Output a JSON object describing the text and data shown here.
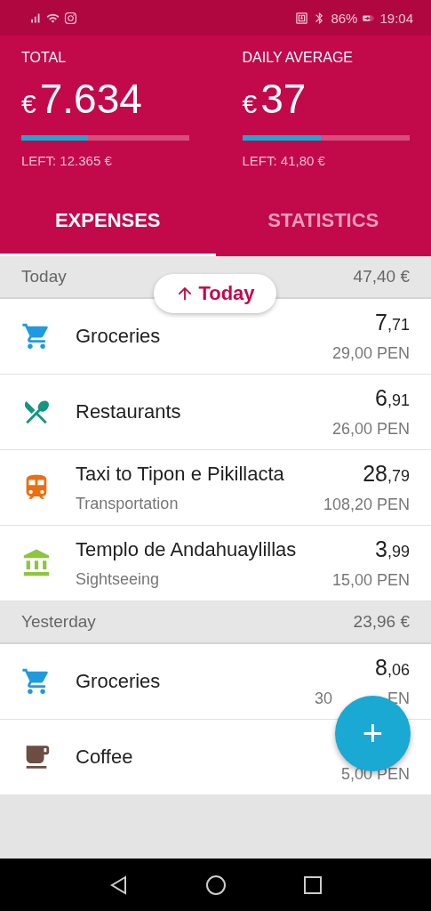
{
  "status_bar": {
    "battery": "86%",
    "time": "19:04"
  },
  "summary": [
    {
      "label": "TOTAL",
      "currency": "€",
      "value": "7.634",
      "level": 0.4,
      "left": "LEFT: 12.365 €"
    },
    {
      "label": "DAILY AVERAGE",
      "currency": "€",
      "value": "37",
      "level": 0.47,
      "left": "LEFT: 41,80 €"
    }
  ],
  "tabs": [
    {
      "label": "EXPENSES",
      "selected": true
    },
    {
      "label": "STATISTICS",
      "selected": false
    }
  ],
  "jump_pill": {
    "label": "Today"
  },
  "sections": [
    {
      "title": "Today",
      "total": "47,40 €",
      "items": [
        {
          "kind": "groceries",
          "name": "Groceries",
          "amount_whole": "7",
          "amount_cents": ",71",
          "original": "29,00 PEN"
        },
        {
          "kind": "restaurants",
          "name": "Restaurants",
          "amount_whole": "6",
          "amount_cents": ",91",
          "original": "26,00 PEN"
        },
        {
          "kind": "transport",
          "name": "Taxi to Tipon e Pikillacta",
          "category": "Transportation",
          "amount_whole": "28",
          "amount_cents": ",79",
          "original": "108,20 PEN"
        },
        {
          "kind": "sightseeing",
          "name": "Templo de Andahuaylillas",
          "category": "Sightseeing",
          "amount_whole": "3",
          "amount_cents": ",99",
          "original": "15,00 PEN"
        }
      ]
    },
    {
      "title": "Yesterday",
      "total": "23,96 €",
      "items": [
        {
          "kind": "groceries",
          "name": "Groceries",
          "amount_whole": "8",
          "amount_cents": ",06",
          "original": "30",
          "original_end": "EN"
        },
        {
          "kind": "coffee",
          "name": "Coffee",
          "original": "5,00 PEN"
        }
      ]
    }
  ],
  "fab": {
    "label": "+"
  }
}
